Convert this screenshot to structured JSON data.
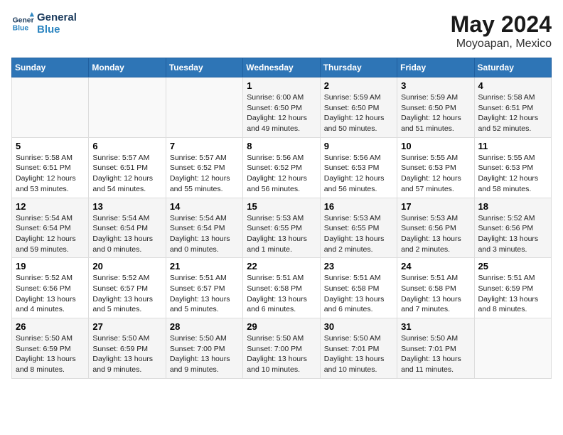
{
  "logo": {
    "line1": "General",
    "line2": "Blue"
  },
  "title": "May 2024",
  "subtitle": "Moyoapan, Mexico",
  "days_of_week": [
    "Sunday",
    "Monday",
    "Tuesday",
    "Wednesday",
    "Thursday",
    "Friday",
    "Saturday"
  ],
  "weeks": [
    [
      {
        "day": "",
        "info": ""
      },
      {
        "day": "",
        "info": ""
      },
      {
        "day": "",
        "info": ""
      },
      {
        "day": "1",
        "info": "Sunrise: 6:00 AM\nSunset: 6:50 PM\nDaylight: 12 hours\nand 49 minutes."
      },
      {
        "day": "2",
        "info": "Sunrise: 5:59 AM\nSunset: 6:50 PM\nDaylight: 12 hours\nand 50 minutes."
      },
      {
        "day": "3",
        "info": "Sunrise: 5:59 AM\nSunset: 6:50 PM\nDaylight: 12 hours\nand 51 minutes."
      },
      {
        "day": "4",
        "info": "Sunrise: 5:58 AM\nSunset: 6:51 PM\nDaylight: 12 hours\nand 52 minutes."
      }
    ],
    [
      {
        "day": "5",
        "info": "Sunrise: 5:58 AM\nSunset: 6:51 PM\nDaylight: 12 hours\nand 53 minutes."
      },
      {
        "day": "6",
        "info": "Sunrise: 5:57 AM\nSunset: 6:51 PM\nDaylight: 12 hours\nand 54 minutes."
      },
      {
        "day": "7",
        "info": "Sunrise: 5:57 AM\nSunset: 6:52 PM\nDaylight: 12 hours\nand 55 minutes."
      },
      {
        "day": "8",
        "info": "Sunrise: 5:56 AM\nSunset: 6:52 PM\nDaylight: 12 hours\nand 56 minutes."
      },
      {
        "day": "9",
        "info": "Sunrise: 5:56 AM\nSunset: 6:53 PM\nDaylight: 12 hours\nand 56 minutes."
      },
      {
        "day": "10",
        "info": "Sunrise: 5:55 AM\nSunset: 6:53 PM\nDaylight: 12 hours\nand 57 minutes."
      },
      {
        "day": "11",
        "info": "Sunrise: 5:55 AM\nSunset: 6:53 PM\nDaylight: 12 hours\nand 58 minutes."
      }
    ],
    [
      {
        "day": "12",
        "info": "Sunrise: 5:54 AM\nSunset: 6:54 PM\nDaylight: 12 hours\nand 59 minutes."
      },
      {
        "day": "13",
        "info": "Sunrise: 5:54 AM\nSunset: 6:54 PM\nDaylight: 13 hours\nand 0 minutes."
      },
      {
        "day": "14",
        "info": "Sunrise: 5:54 AM\nSunset: 6:54 PM\nDaylight: 13 hours\nand 0 minutes."
      },
      {
        "day": "15",
        "info": "Sunrise: 5:53 AM\nSunset: 6:55 PM\nDaylight: 13 hours\nand 1 minute."
      },
      {
        "day": "16",
        "info": "Sunrise: 5:53 AM\nSunset: 6:55 PM\nDaylight: 13 hours\nand 2 minutes."
      },
      {
        "day": "17",
        "info": "Sunrise: 5:53 AM\nSunset: 6:56 PM\nDaylight: 13 hours\nand 2 minutes."
      },
      {
        "day": "18",
        "info": "Sunrise: 5:52 AM\nSunset: 6:56 PM\nDaylight: 13 hours\nand 3 minutes."
      }
    ],
    [
      {
        "day": "19",
        "info": "Sunrise: 5:52 AM\nSunset: 6:56 PM\nDaylight: 13 hours\nand 4 minutes."
      },
      {
        "day": "20",
        "info": "Sunrise: 5:52 AM\nSunset: 6:57 PM\nDaylight: 13 hours\nand 5 minutes."
      },
      {
        "day": "21",
        "info": "Sunrise: 5:51 AM\nSunset: 6:57 PM\nDaylight: 13 hours\nand 5 minutes."
      },
      {
        "day": "22",
        "info": "Sunrise: 5:51 AM\nSunset: 6:58 PM\nDaylight: 13 hours\nand 6 minutes."
      },
      {
        "day": "23",
        "info": "Sunrise: 5:51 AM\nSunset: 6:58 PM\nDaylight: 13 hours\nand 6 minutes."
      },
      {
        "day": "24",
        "info": "Sunrise: 5:51 AM\nSunset: 6:58 PM\nDaylight: 13 hours\nand 7 minutes."
      },
      {
        "day": "25",
        "info": "Sunrise: 5:51 AM\nSunset: 6:59 PM\nDaylight: 13 hours\nand 8 minutes."
      }
    ],
    [
      {
        "day": "26",
        "info": "Sunrise: 5:50 AM\nSunset: 6:59 PM\nDaylight: 13 hours\nand 8 minutes."
      },
      {
        "day": "27",
        "info": "Sunrise: 5:50 AM\nSunset: 6:59 PM\nDaylight: 13 hours\nand 9 minutes."
      },
      {
        "day": "28",
        "info": "Sunrise: 5:50 AM\nSunset: 7:00 PM\nDaylight: 13 hours\nand 9 minutes."
      },
      {
        "day": "29",
        "info": "Sunrise: 5:50 AM\nSunset: 7:00 PM\nDaylight: 13 hours\nand 10 minutes."
      },
      {
        "day": "30",
        "info": "Sunrise: 5:50 AM\nSunset: 7:01 PM\nDaylight: 13 hours\nand 10 minutes."
      },
      {
        "day": "31",
        "info": "Sunrise: 5:50 AM\nSunset: 7:01 PM\nDaylight: 13 hours\nand 11 minutes."
      },
      {
        "day": "",
        "info": ""
      }
    ]
  ]
}
